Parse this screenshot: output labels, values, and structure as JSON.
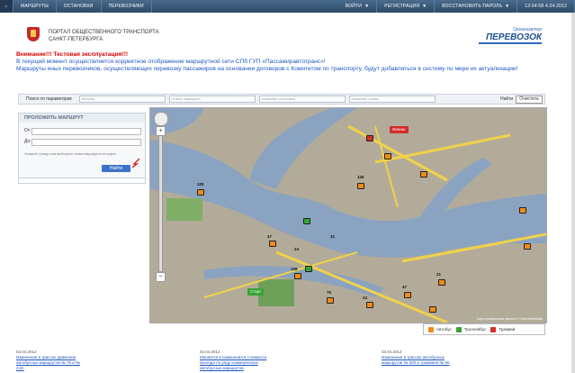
{
  "topnav": {
    "items": [
      "МАРШРУТЫ",
      "ОСТАНОВКИ",
      "ПЕРЕВОЗЧИКИ"
    ],
    "right": [
      "ВОЙТИ",
      "РЕГИСТРАЦИЯ",
      "ВОССТАНОВИТЬ ПАРОЛЬ"
    ],
    "time": "13:04:58 4.24.2013"
  },
  "header": {
    "portal_line1": "ПОРТАЛ ОБЩЕСТВЕННОГО ТРАНСПОРТА",
    "portal_line2": "САНКТ-ПЕТЕРБУРГА",
    "logo_top": "Организатор",
    "logo_main": "ПЕРЕВОЗОК"
  },
  "notice": {
    "warning": "Внимание!!! Тестовая эксплуатация!!!",
    "line1": "В текущий момент осуществляется корректное отображение маршрутной сети СПб ГУП «Пассажиравтотранс»!",
    "line2": "Маршруты иных перевозчиков, осуществляющих перевозку пассажиров на основании договоров с Комитетом по транспорту, будут добавляться в систему по мере их актуализации!"
  },
  "search": {
    "label": "Поиск по параметрам",
    "fields": [
      "Автобус",
      "Номер маршрута",
      "Название остановки",
      "Название улицы"
    ],
    "find": "Найти",
    "clear": "Очистить"
  },
  "route": {
    "title": "ПРОЛОЖИТЬ МАРШРУТ",
    "from": "От:",
    "to": "До:",
    "hint": "Укажите улицу или выберите точки маршрута на карте",
    "button": "Найти"
  },
  "map": {
    "labels": [
      "128",
      "100",
      "47",
      "24",
      "31",
      "128",
      "76",
      "24",
      "47",
      "21"
    ],
    "start": "Старт",
    "finish": "Финиш",
    "copyright": "Картографические данные © OpenStreetMap"
  },
  "legend": {
    "items": [
      {
        "label": "Автобус",
        "color": "#f08a18"
      },
      {
        "label": "Троллейбус",
        "color": "#36a436"
      },
      {
        "label": "Трамвай",
        "color": "#d32d2d"
      }
    ]
  },
  "news": [
    {
      "date": "03.04.2013",
      "title": "Изменения в трассах движения автобусных маршрутов № 76 и № 2ЭА"
    },
    {
      "date": "02.04.2013",
      "title": "Меняется в изменения в стоимости проезда по ряду коммерческих автобусных маршрутов"
    },
    {
      "date": "03.04.2013",
      "title": "Изменения в трассах автобусных маршрутов № 300 и трамваев № 60"
    }
  ]
}
